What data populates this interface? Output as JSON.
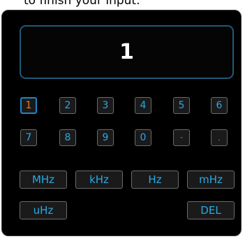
{
  "caption": "to finish your input.",
  "display": {
    "value": "1"
  },
  "keypad": {
    "row1": [
      "1",
      "2",
      "3",
      "4",
      "5",
      "6"
    ],
    "row2": [
      "7",
      "8",
      "9",
      "0",
      "-",
      "."
    ],
    "selected": "1"
  },
  "units": {
    "mhz_upper": "MHz",
    "khz": "kHz",
    "hz": "Hz",
    "mhz_lower": "mHz",
    "uhz": "uHz",
    "del": "DEL"
  },
  "colors": {
    "panel_bg": "#000000",
    "key_text": "#2aa9e6",
    "selected_text": "#f07a2a",
    "selected_border": "#1d86c7",
    "disabled_text": "#5e5e5e",
    "display_border": "#1f5a78"
  }
}
